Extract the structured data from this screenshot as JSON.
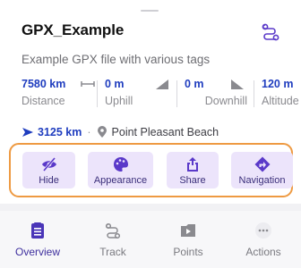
{
  "header": {
    "title": "GPX_Example",
    "subtitle": "Example GPX file with various tags",
    "route_icon": "route-icon"
  },
  "stats": [
    {
      "value": "7580 km",
      "label": "Distance",
      "icon": "distance-icon"
    },
    {
      "value": "0 m",
      "label": "Uphill",
      "icon": "uphill-icon"
    },
    {
      "value": "0 m",
      "label": "Downhill",
      "icon": "downhill-icon"
    },
    {
      "value": "120 m",
      "label": "Altitude"
    }
  ],
  "location": {
    "distance": "3125 km",
    "separator": "·",
    "place": "Point Pleasant Beach"
  },
  "actions": [
    {
      "label": "Hide",
      "icon": "eye-slash-icon"
    },
    {
      "label": "Appearance",
      "icon": "palette-icon"
    },
    {
      "label": "Share",
      "icon": "share-icon"
    },
    {
      "label": "Navigation",
      "icon": "navigation-icon"
    }
  ],
  "tabs": [
    {
      "label": "Overview",
      "icon": "overview-icon",
      "active": true
    },
    {
      "label": "Track",
      "icon": "track-icon",
      "active": false
    },
    {
      "label": "Points",
      "icon": "points-icon",
      "active": false
    },
    {
      "label": "Actions",
      "icon": "more-icon",
      "active": false
    }
  ],
  "colors": {
    "accent": "#1f3dbf",
    "action_bg": "#ece4fb",
    "action_icon": "#5a39c9",
    "highlight_border": "#ee9a42",
    "active_tab": "#3e2f9e"
  }
}
